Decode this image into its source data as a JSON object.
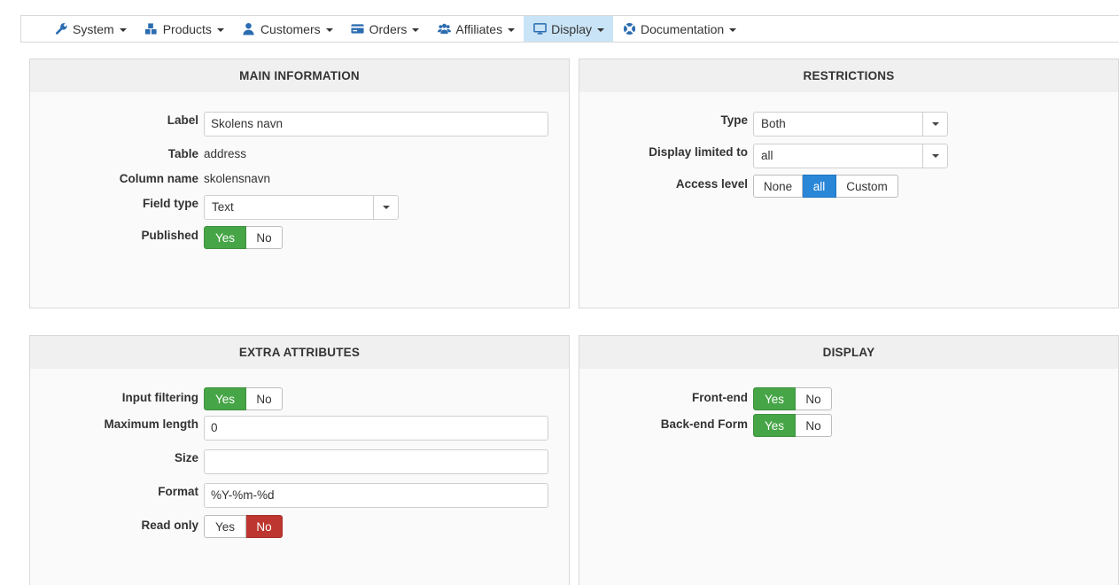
{
  "nav": {
    "items": [
      {
        "label": "System",
        "icon": "wrench-icon"
      },
      {
        "label": "Products",
        "icon": "cubes-icon"
      },
      {
        "label": "Customers",
        "icon": "user-icon"
      },
      {
        "label": "Orders",
        "icon": "credit-card-icon"
      },
      {
        "label": "Affiliates",
        "icon": "users-icon"
      },
      {
        "label": "Display",
        "icon": "monitor-icon",
        "active": true
      },
      {
        "label": "Documentation",
        "icon": "lifebuoy-icon"
      }
    ],
    "active_color": "#c9e4f6"
  },
  "main_info": {
    "title": "MAIN INFORMATION",
    "label_label": "Label",
    "label_value": "Skolens navn",
    "table_label": "Table",
    "table_value": "address",
    "column_label": "Column name",
    "column_value": "skolensnavn",
    "field_type_label": "Field type",
    "field_type_value": "Text",
    "published_label": "Published",
    "published_yes": "Yes",
    "published_no": "No"
  },
  "restrictions": {
    "title": "RESTRICTIONS",
    "type_label": "Type",
    "type_value": "Both",
    "limited_label": "Display limited to",
    "limited_value": "all",
    "access_label": "Access level",
    "access_none": "None",
    "access_all": "all",
    "access_custom": "Custom"
  },
  "extra": {
    "title": "EXTRA ATTRIBUTES",
    "filter_label": "Input filtering",
    "filter_yes": "Yes",
    "filter_no": "No",
    "maxlen_label": "Maximum length",
    "maxlen_value": "0",
    "size_label": "Size",
    "size_value": "",
    "format_label": "Format",
    "format_value": "%Y-%m-%d",
    "readonly_label": "Read only",
    "readonly_yes": "Yes",
    "readonly_no": "No"
  },
  "display": {
    "title": "DISPLAY",
    "frontend_label": "Front-end",
    "frontend_yes": "Yes",
    "frontend_no": "No",
    "backend_label": "Back-end Form",
    "backend_yes": "Yes",
    "backend_no": "No"
  },
  "colors": {
    "green": "#46a546",
    "red": "#bd362f",
    "blue": "#2a87d8"
  }
}
